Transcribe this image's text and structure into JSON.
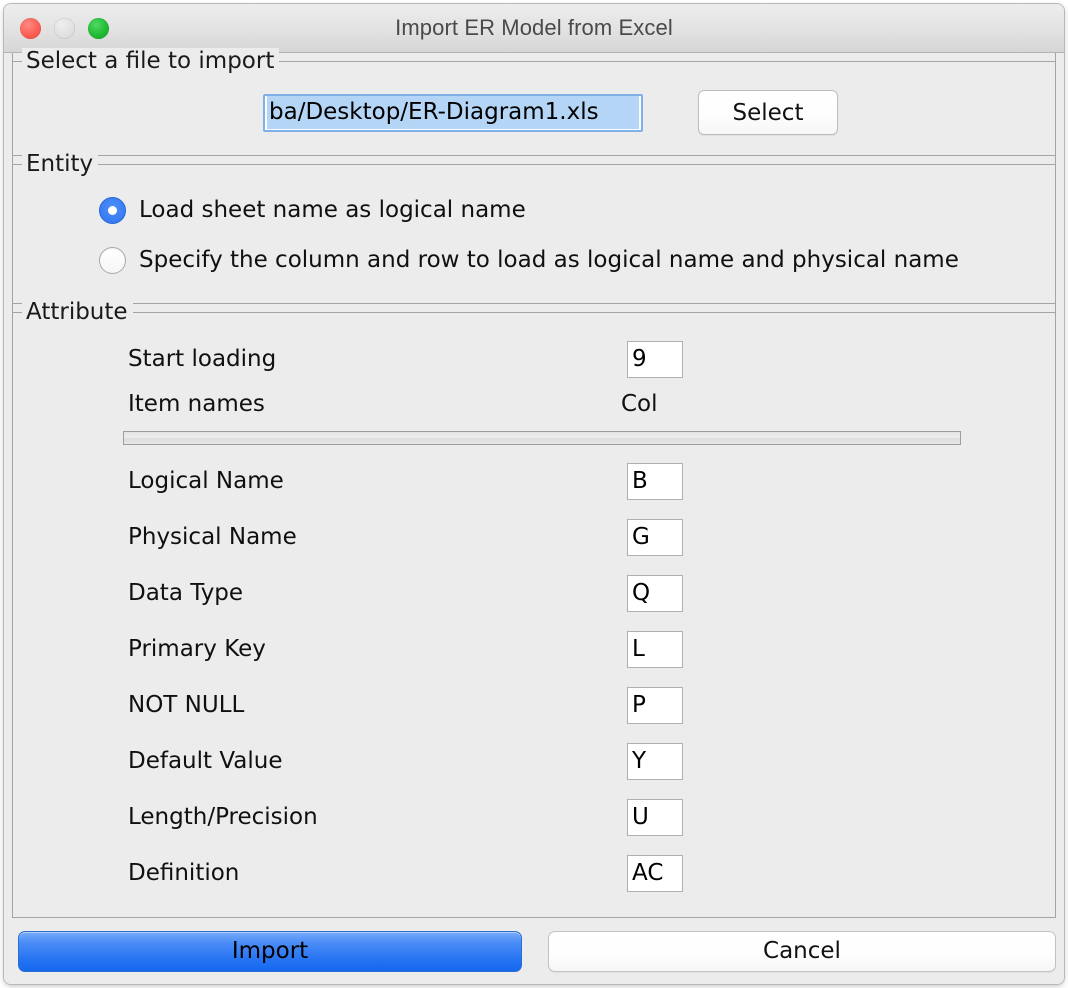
{
  "window": {
    "title": "Import ER Model from Excel",
    "controls": {
      "close": "close-button",
      "minimize": "minimize-button",
      "zoom": "zoom-button"
    }
  },
  "file_group": {
    "title": "Select a file to import",
    "path_value": "ba/Desktop/ER-Diagram1.xls",
    "select_label": "Select"
  },
  "entity_group": {
    "title": "Entity",
    "options": [
      {
        "label": "Load sheet name as logical name",
        "selected": true
      },
      {
        "label": "Specify the column and row to load as logical name and physical name",
        "selected": false
      }
    ]
  },
  "attribute_group": {
    "title": "Attribute",
    "start_loading_label": "Start loading",
    "start_loading_value": "9",
    "header_item_names": "Item names",
    "header_col": "Col",
    "rows": [
      {
        "label": "Logical Name",
        "value": "B"
      },
      {
        "label": "Physical Name",
        "value": "G"
      },
      {
        "label": "Data Type",
        "value": "Q"
      },
      {
        "label": "Primary Key",
        "value": "L"
      },
      {
        "label": "NOT NULL",
        "value": "P"
      },
      {
        "label": "Default Value",
        "value": "Y"
      },
      {
        "label": "Length/Precision",
        "value": "U"
      },
      {
        "label": "Definition",
        "value": "AC"
      }
    ]
  },
  "footer": {
    "import_label": "Import",
    "cancel_label": "Cancel"
  },
  "colors": {
    "accent_blue": "#2473f2",
    "selection_blue": "#b4d5f5",
    "radio_blue": "#3b7ff5",
    "window_bg": "#ececec"
  }
}
